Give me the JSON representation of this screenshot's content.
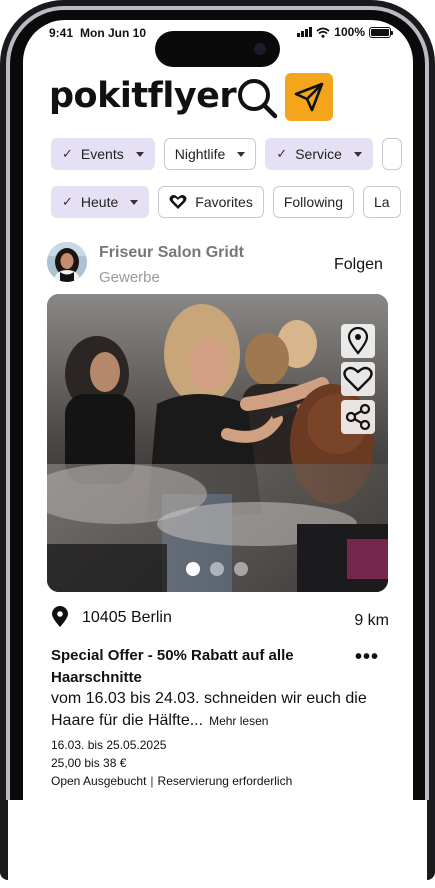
{
  "status_bar": {
    "time": "9:41",
    "date": "Mon Jun 10",
    "battery": "100%"
  },
  "header": {
    "logo": "pokitflyer",
    "search_icon": "search-icon",
    "send_icon": "paper-plane-icon",
    "accent_color": "#f4a51c"
  },
  "filters_row1": [
    {
      "label": "Events",
      "selected": true
    },
    {
      "label": "Nightlife",
      "selected": false
    },
    {
      "label": "Service",
      "selected": true
    }
  ],
  "filters_row2": [
    {
      "label": "Heute",
      "selected": true
    },
    {
      "label": "Favorites",
      "selected": false
    },
    {
      "label": "Following",
      "selected": false
    },
    {
      "label": "La",
      "selected": false
    }
  ],
  "post": {
    "author_name": "Friseur Salon Gridt",
    "author_category": "Gewerbe",
    "follow_label": "Folgen",
    "location": "10405 Berlin",
    "distance": "9 km",
    "title": "Special Offer - 50% Rabatt auf alle Haarschnitte",
    "description": "vom 16.03 bis 24.03. schneiden wir euch die Haare für die Hälfte...",
    "read_more": "Mehr lesen",
    "dates": "16.03. bis 25.05.2025",
    "price": "25,00 bis 38 €",
    "status_open": "Open Ausgebucht",
    "status_reservation": "Reservierung erforderlich",
    "more_icon": "•••"
  },
  "colors": {
    "chip_selected": "#e6e0f4",
    "accent": "#f4a51c"
  }
}
